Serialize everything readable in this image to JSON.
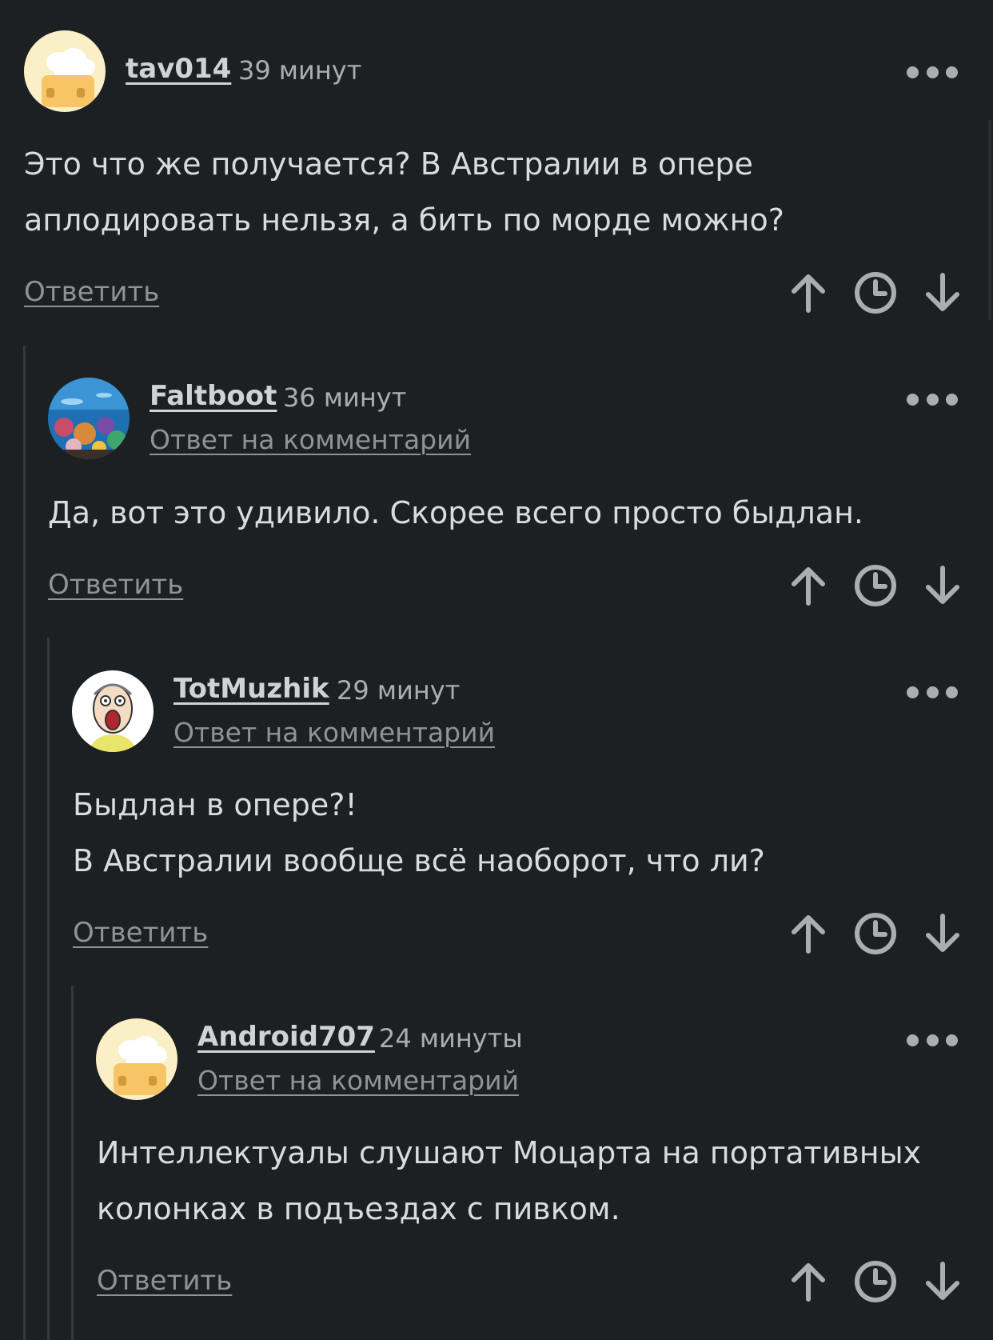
{
  "comments": [
    {
      "username": "tav014",
      "time": "39 минут",
      "reply_to": "",
      "lines": [
        "Это что же получается? В Австралии в опере",
        "аплодировать нельзя, а бить по морде можно?"
      ],
      "reply_label": "Ответить",
      "avatar": "chef-hat-avatar"
    },
    {
      "username": "Faltboot",
      "time": "36 минут",
      "reply_to": "Ответ на комментарий",
      "lines": [
        "Да, вот это удивило. Скорее всего просто быдлан."
      ],
      "reply_label": "Ответить",
      "avatar": "coral-reef-avatar"
    },
    {
      "username": "TotMuzhik",
      "time": "29 минут",
      "reply_to": "Ответ на комментарий",
      "lines": [
        "Быдлан в опере?!",
        "В Австралии вообще всё наоборот, что ли?"
      ],
      "reply_label": "Ответить",
      "avatar": "cartoon-man-avatar"
    },
    {
      "username": "Android707",
      "time": "24 минуты",
      "reply_to": "Ответ на комментарий",
      "lines": [
        "Интеллектуалы слушают Моцарта на портативных",
        "колонках в подъездах с пивком."
      ],
      "reply_label": "Ответить",
      "avatar": "chef-hat-avatar"
    }
  ],
  "icons": {
    "more": "more-dots-icon",
    "upvote": "arrow-up-icon",
    "save": "clock-icon",
    "downvote": "arrow-down-icon"
  },
  "colors": {
    "background": "#1c2023",
    "text": "#d9dcdf",
    "muted": "#8e9398",
    "thread_line": "#33393e"
  }
}
